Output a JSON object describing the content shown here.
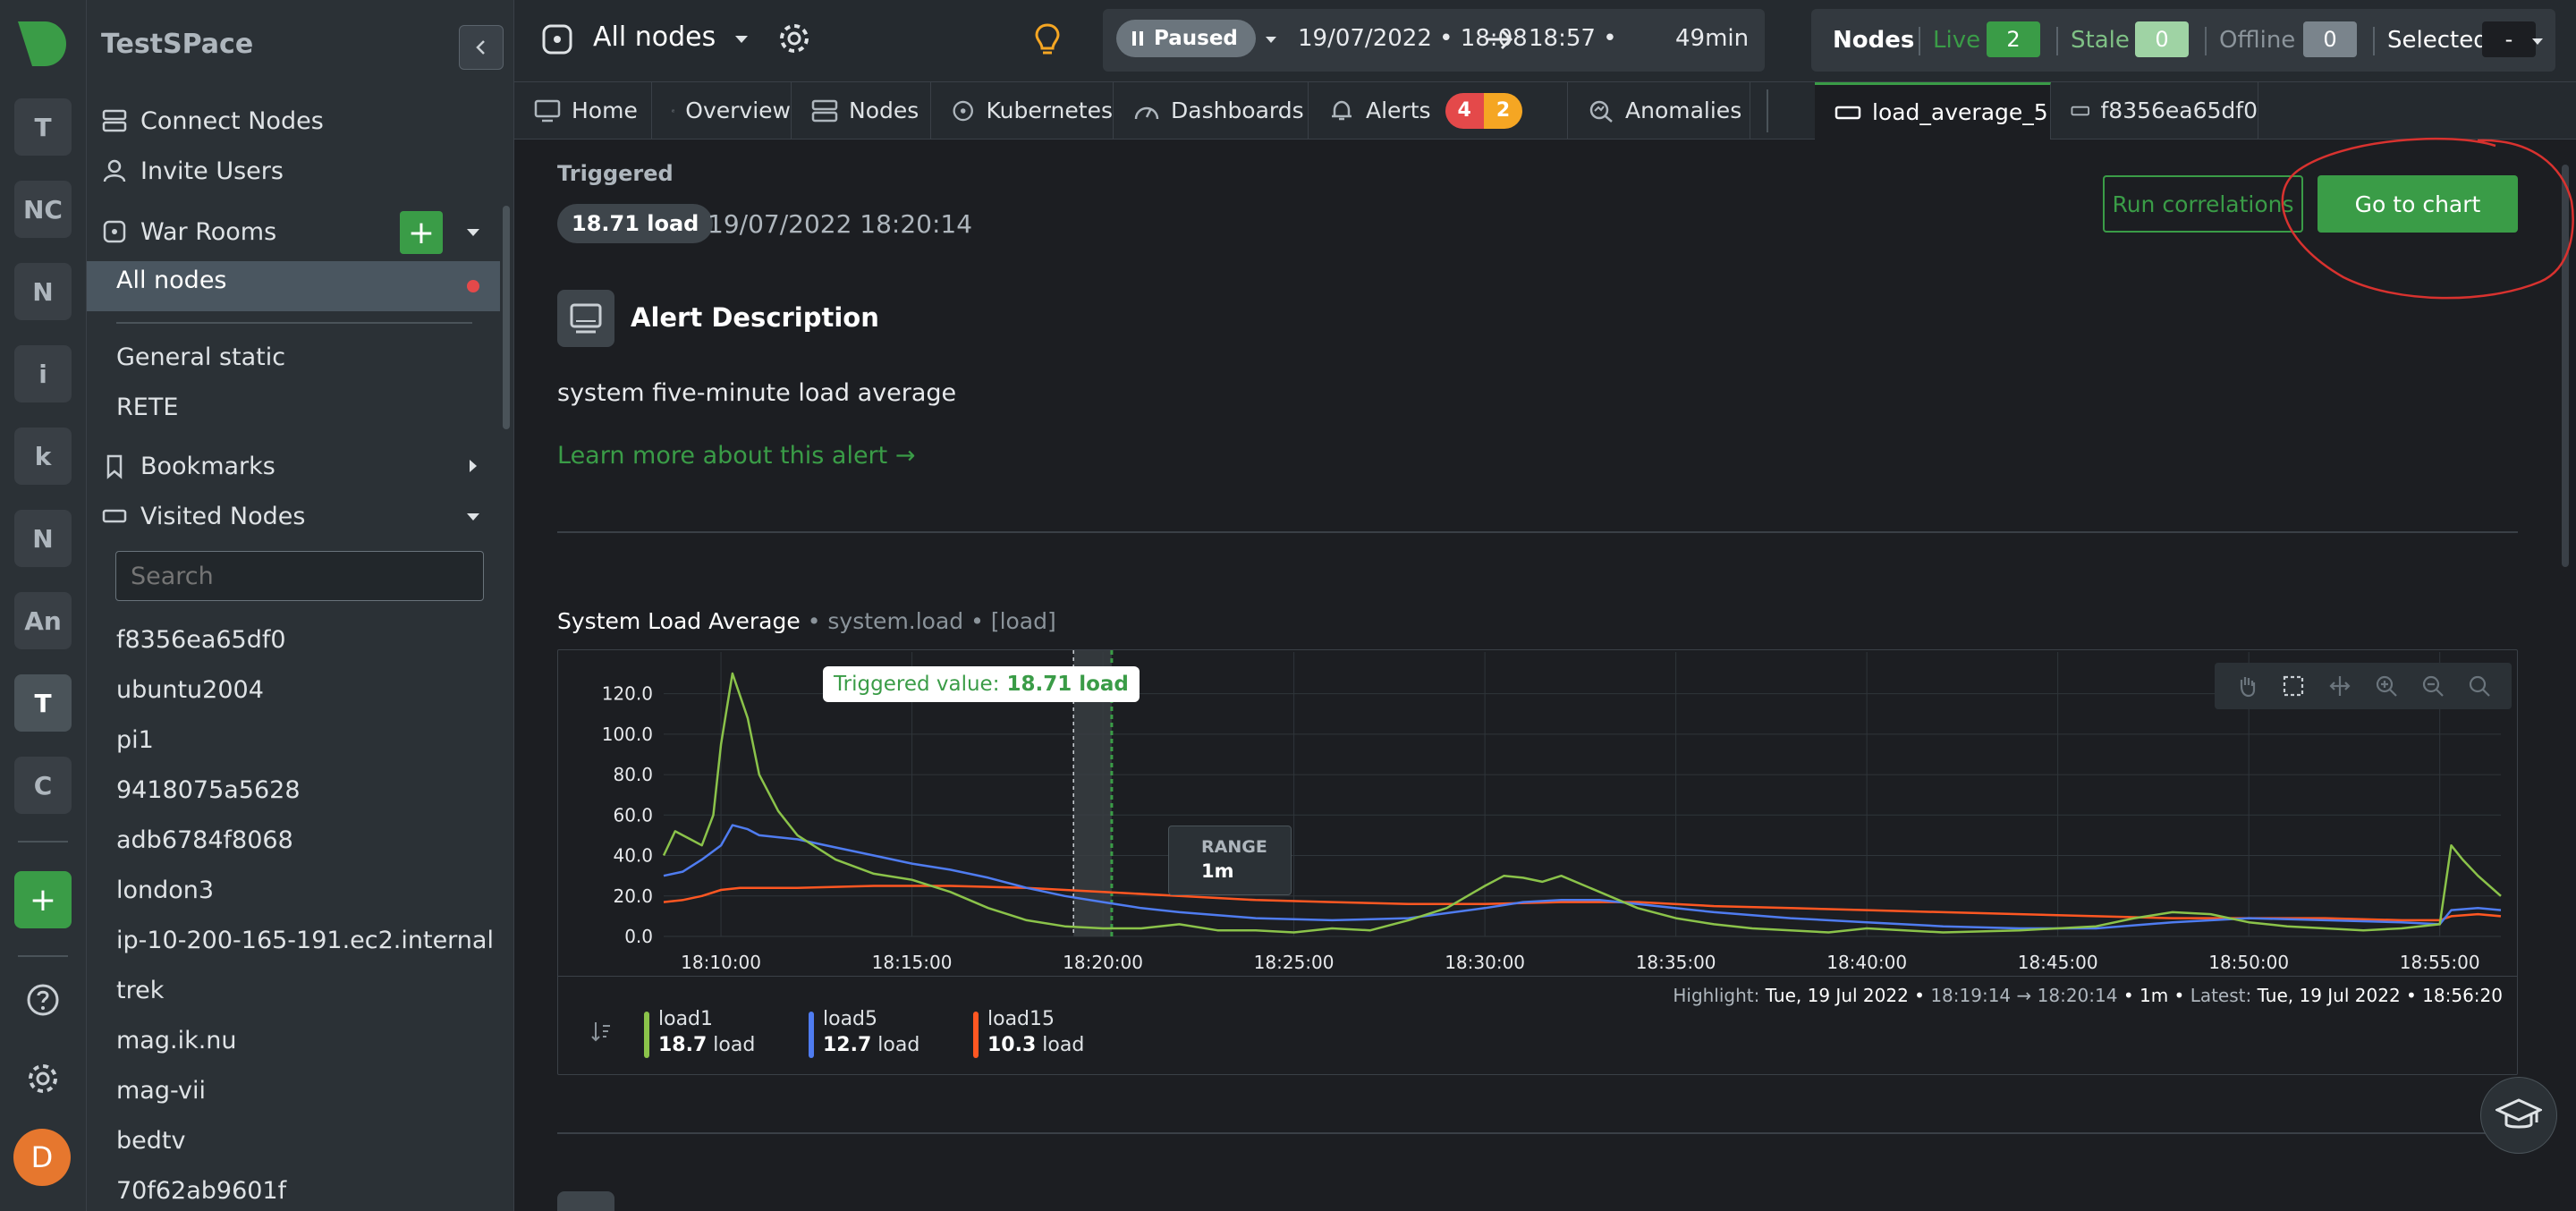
{
  "space": {
    "name": "TestSPace"
  },
  "rail": {
    "spaces": [
      "T",
      "NC",
      "N",
      "i",
      "k",
      "N",
      "An",
      "T",
      "C"
    ],
    "add_label": "+",
    "avatar_letter": "D"
  },
  "sidebar": {
    "connect_nodes": "Connect Nodes",
    "invite_users": "Invite Users",
    "war_rooms": "War Rooms",
    "add_room": "+",
    "active_room": "All nodes",
    "rooms": [
      "General static",
      "RETE"
    ],
    "bookmarks": "Bookmarks",
    "visited_nodes": "Visited Nodes",
    "search_placeholder": "Search",
    "nodes": [
      "f8356ea65df0",
      "ubuntu2004",
      "pi1",
      "9418075a5628",
      "adb6784f8068",
      "london3",
      "ip-10-200-165-191.ec2.internal",
      "trek",
      "mag.ik.nu",
      "mag-vii",
      "bedtv",
      "70f62ab9601f"
    ]
  },
  "topbar": {
    "room": "All nodes",
    "paused": "Paused",
    "time_start": "19/07/2022 • 18:08",
    "time_end": "18:57 •",
    "duration": "49min",
    "nodes_label": "Nodes",
    "live_label": "Live",
    "live_count": "2",
    "stale_label": "Stale",
    "stale_count": "0",
    "offline_label": "Offline",
    "offline_count": "0",
    "selected_label": "Selected",
    "selected_value": "-"
  },
  "tabs": {
    "home": "Home",
    "overview": "Overview",
    "nodes": "Nodes",
    "kubernetes": "Kubernetes",
    "dashboards": "Dashboards",
    "alerts": "Alerts",
    "alerts_critical": "4",
    "alerts_warning": "2",
    "anomalies": "Anomalies",
    "active_tab": "load_average_5",
    "node_tab": "f8356ea65df0"
  },
  "alert": {
    "triggered_label": "Triggered",
    "load_value": "18.71 load",
    "date": "19/07/2022 18:20:14",
    "run_correlations": "Run correlations",
    "go_to_chart": "Go to chart",
    "description_title": "Alert Description",
    "description": "system five-minute load average",
    "learn_more": "Learn more about this alert →"
  },
  "chart": {
    "title": "System Load Average",
    "context": "• system.load • [load]",
    "triggered_prefix": "Triggered value:",
    "triggered_value": "18.71 load",
    "range_label": "RANGE",
    "range_value": "1m",
    "highlight_label": "Highlight:",
    "highlight_date": "Tue, 19 Jul 2022 •",
    "highlight_range": "18:19:14 → 18:20:14",
    "highlight_duration": "• 1m •",
    "latest_label": "Latest:",
    "latest_date": "Tue, 19 Jul 2022 • 18:56:20"
  },
  "colors": {
    "load1": "#8bc34a",
    "load5": "#4f7cf0",
    "load15": "#ff5722",
    "accent": "#3a9c47",
    "critical": "#e4494a",
    "warning": "#f5a623"
  },
  "chart_data": {
    "type": "line",
    "title": "System Load Average",
    "ylabel": "",
    "xlabel": "",
    "ylim": [
      0,
      130
    ],
    "yticks": [
      "0.0",
      "20.0",
      "40.0",
      "60.0",
      "80.0",
      "100.0",
      "120.0"
    ],
    "xticks": [
      "18:10:00",
      "18:15:00",
      "18:20:00",
      "18:25:00",
      "18:30:00",
      "18:35:00",
      "18:40:00",
      "18:45:00",
      "18:50:00",
      "18:55:00"
    ],
    "x_minutes_range": [
      8.5,
      56.6
    ],
    "highlight_minutes": [
      19.23,
      20.23
    ],
    "grid": true,
    "series": [
      {
        "name": "load1",
        "unit": "load",
        "legend_value": "18.7",
        "x": [
          8.5,
          8.8,
          9.2,
          9.5,
          9.8,
          10.0,
          10.3,
          10.7,
          11.0,
          11.5,
          12.0,
          13.0,
          14.0,
          15.0,
          16.0,
          17.0,
          18.0,
          19.0,
          20.0,
          21.0,
          22.0,
          23.0,
          24.0,
          25.0,
          26.0,
          27.0,
          28.0,
          29.0,
          30.0,
          30.5,
          31.0,
          31.5,
          32.0,
          33.0,
          34.0,
          35.0,
          36.0,
          37.0,
          38.0,
          39.0,
          40.0,
          42.0,
          44.0,
          46.0,
          47.0,
          48.0,
          49.0,
          50.0,
          51.0,
          52.0,
          53.0,
          54.0,
          55.0,
          55.3,
          55.6,
          56.0,
          56.6
        ],
        "y": [
          40,
          52,
          48,
          45,
          60,
          95,
          130,
          108,
          80,
          62,
          50,
          38,
          31,
          28,
          22,
          14,
          8,
          5,
          4,
          4,
          6,
          3,
          3,
          2,
          4,
          3,
          8,
          14,
          25,
          30,
          29,
          27,
          30,
          22,
          14,
          9,
          6,
          4,
          3,
          2,
          4,
          2,
          3,
          5,
          9,
          12,
          11,
          7,
          5,
          4,
          3,
          4,
          6,
          45,
          38,
          30,
          20
        ]
      },
      {
        "name": "load5",
        "unit": "load",
        "legend_value": "12.7",
        "x": [
          8.5,
          9.0,
          9.5,
          10.0,
          10.3,
          10.7,
          11.0,
          12.0,
          13.0,
          14.0,
          15.0,
          16.0,
          17.0,
          18.0,
          19.0,
          20.0,
          21.0,
          22.0,
          24.0,
          26.0,
          28.0,
          30.0,
          31.0,
          32.0,
          33.0,
          34.0,
          36.0,
          38.0,
          40.0,
          42.0,
          44.0,
          46.0,
          48.0,
          50.0,
          52.0,
          54.0,
          55.0,
          55.3,
          56.0,
          56.6
        ],
        "y": [
          30,
          32,
          38,
          45,
          55,
          53,
          50,
          48,
          44,
          40,
          36,
          33,
          29,
          24,
          20,
          17,
          14,
          12,
          9,
          8,
          9,
          14,
          17,
          18,
          18,
          16,
          12,
          9,
          7,
          5,
          4,
          4,
          7,
          9,
          8,
          7,
          6,
          13,
          14,
          13
        ]
      },
      {
        "name": "load15",
        "unit": "load",
        "legend_value": "10.3",
        "x": [
          8.5,
          9.0,
          9.5,
          10.0,
          10.5,
          11.0,
          12.0,
          14.0,
          16.0,
          18.0,
          20.0,
          22.0,
          24.0,
          26.0,
          28.0,
          30.0,
          32.0,
          34.0,
          36.0,
          38.0,
          40.0,
          42.0,
          44.0,
          46.0,
          48.0,
          50.0,
          52.0,
          54.0,
          55.0,
          55.3,
          56.0,
          56.6
        ],
        "y": [
          17,
          18,
          20,
          23,
          24,
          24,
          24,
          25,
          25,
          24,
          22,
          20,
          18,
          17,
          16,
          16,
          17,
          17,
          15,
          14,
          13,
          12,
          11,
          10,
          9,
          9,
          9,
          8,
          8,
          10,
          11,
          10
        ]
      }
    ]
  }
}
